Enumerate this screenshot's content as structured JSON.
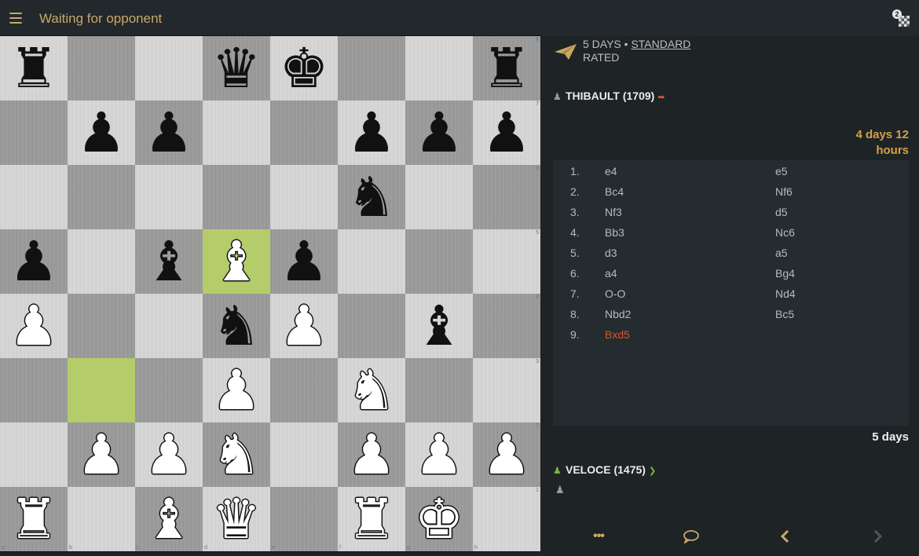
{
  "header": {
    "title": "Waiting for opponent",
    "notification_count": "2"
  },
  "game": {
    "time_control": "5 DAYS",
    "separator": " • ",
    "variant": "STANDARD",
    "rated": "RATED"
  },
  "opponent": {
    "name": "THIBAULT (1709)",
    "clock": "4 days 12 hours",
    "status": "left"
  },
  "player": {
    "name": "VELOCE (1475)",
    "clock": "5 days",
    "status": "connected"
  },
  "moves": [
    {
      "num": "1.",
      "white": "e4",
      "black": "e5"
    },
    {
      "num": "2.",
      "white": "Bc4",
      "black": "Nf6"
    },
    {
      "num": "3.",
      "white": "Nf3",
      "black": "d5"
    },
    {
      "num": "4.",
      "white": "Bb3",
      "black": "Nc6"
    },
    {
      "num": "5.",
      "white": "d3",
      "black": "a5"
    },
    {
      "num": "6.",
      "white": "a4",
      "black": "Bg4"
    },
    {
      "num": "7.",
      "white": "O-O",
      "black": "Nd4"
    },
    {
      "num": "8.",
      "white": "Nbd2",
      "black": "Bc5"
    },
    {
      "num": "9.",
      "white": "Bxd5",
      "black": ""
    }
  ],
  "board": {
    "rows": [
      [
        "r",
        "",
        "",
        "q",
        "k",
        "",
        "",
        "r"
      ],
      [
        "",
        "p",
        "p",
        "",
        "",
        "p",
        "p",
        "p"
      ],
      [
        "",
        "",
        "",
        "",
        "",
        "n",
        "",
        ""
      ],
      [
        "p",
        "",
        "b",
        "B",
        "p",
        "",
        "",
        ""
      ],
      [
        "P",
        "",
        "",
        "n",
        "P",
        "",
        "b",
        ""
      ],
      [
        "",
        "",
        "",
        "P",
        "",
        "N",
        "",
        ""
      ],
      [
        "",
        "P",
        "P",
        "N",
        "",
        "P",
        "P",
        "P"
      ],
      [
        "R",
        "",
        "B",
        "Q",
        "",
        "R",
        "K",
        ""
      ]
    ],
    "highlight_squares": [
      "d5",
      "b3"
    ],
    "rank_labels": [
      "8",
      "7",
      "6",
      "5",
      "4",
      "3",
      "2",
      "1"
    ],
    "file_labels": [
      "a",
      "b",
      "c",
      "d",
      "e",
      "f",
      "g",
      "h"
    ]
  },
  "icons": {
    "menu": "hamburger-menu-icon",
    "notifications": "notifications-icon",
    "game_type": "paper-plane-icon",
    "player": "user-icon",
    "more": "ellipsis-icon",
    "chat": "chat-bubble-icon",
    "prev": "chevron-left-icon",
    "next": "chevron-right-icon"
  },
  "colors": {
    "accent": "#c9a967",
    "opponent_clock": "#d5a047",
    "current_move": "#d8542a",
    "highlight": "#b4cc6a",
    "online": "#7cb342",
    "offline_signal": "#d85a3a"
  }
}
